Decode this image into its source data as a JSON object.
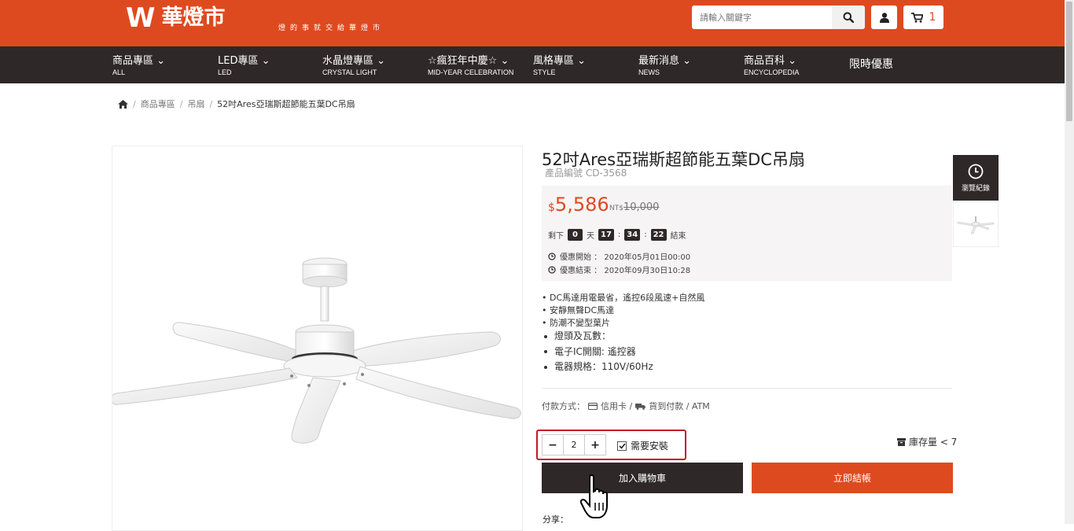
{
  "header": {
    "brand": "華燈市",
    "tagline": "燈的事就交給華燈市",
    "search_placeholder": "請輸入關鍵字",
    "cart_count": "1",
    "accent_color": "#de4a1f",
    "dark_color": "#2f2828"
  },
  "nav": {
    "items": [
      {
        "zh": "商品專區",
        "en": "ALL"
      },
      {
        "zh": "LED專區",
        "en": "LED"
      },
      {
        "zh": "水晶燈專區",
        "en": "CRYSTAL LIGHT"
      },
      {
        "zh": "☆瘋狂年中慶☆",
        "en": "MID-YEAR CELEBRATION"
      },
      {
        "zh": "風格專區",
        "en": "STYLE"
      },
      {
        "zh": "最新消息",
        "en": "NEWS"
      },
      {
        "zh": "商品百科",
        "en": "ENCYCLOPEDIA"
      }
    ],
    "promo": "限時優惠"
  },
  "breadcrumb": {
    "items": [
      "商品專區",
      "吊扇"
    ],
    "current": "52吋Ares亞瑞斯超節能五葉DC吊扇"
  },
  "product": {
    "title": "52吋Ares亞瑞斯超節能五葉DC吊扇",
    "code": "產品編號 CD-3568",
    "price_currency": "$",
    "price": "5,586",
    "old_price_label": "NT$",
    "old_price": "10,000",
    "countdown": {
      "prefix": "剩下",
      "days": "0",
      "day_unit": "天",
      "hours": "17",
      "minutes": "34",
      "seconds": "22",
      "suffix": "結束"
    },
    "promo_start": "優惠開始 ： 2020年05月01日00:00",
    "promo_end": "優惠結束 ： 2020年09月30日10:28",
    "features": [
      "• DC馬達用電最省，遙控6段風速+自然風",
      "• 安靜無聲DC馬達",
      "• 防潮不變型葉片"
    ],
    "specs": [
      "燈頭及瓦數：",
      "電子IC開關: 遙控器",
      "電器規格：110V/60Hz"
    ],
    "payment_label": "付款方式：",
    "payment_card": "信用卡 /",
    "payment_cod": "貨到付款 / ATM",
    "quantity": "2",
    "install_label": "需要安裝",
    "install_checked": true,
    "stock": "庫存量 < 7",
    "add_to_cart": "加入購物車",
    "buy_now": "立即結帳",
    "share_label": "分享："
  },
  "history": {
    "label": "瀏覽紀錄"
  }
}
